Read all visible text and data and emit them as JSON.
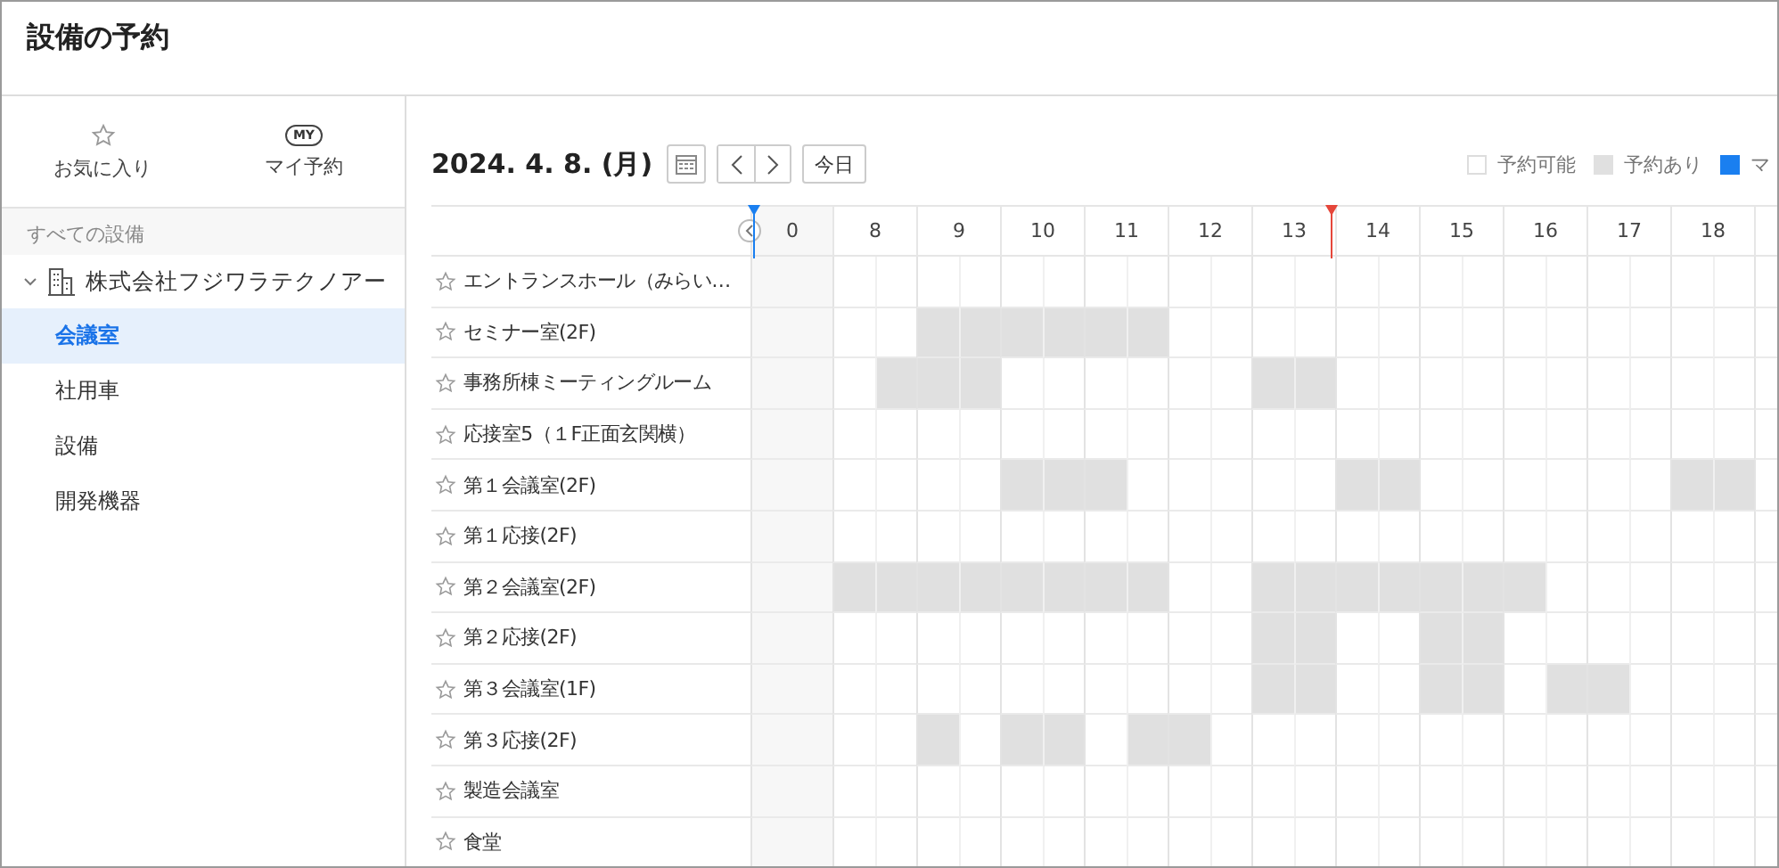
{
  "window": {
    "title": "設備の予約"
  },
  "sidebar": {
    "tabs": [
      {
        "kind": "favorites",
        "label": "お気に入り"
      },
      {
        "kind": "mine",
        "label": "マイ予約",
        "icon_text": "MY"
      }
    ],
    "section_title": "すべての設備",
    "tree": [
      {
        "label": "株式会社フジワラテクノアー",
        "expanded": true,
        "children": [
          {
            "label": "会議室",
            "selected": true
          },
          {
            "label": "社用車",
            "selected": false
          },
          {
            "label": "設備",
            "selected": false
          },
          {
            "label": "開発機器",
            "selected": false
          }
        ]
      }
    ]
  },
  "toolbar": {
    "date": "2024. 4. 8. (月)",
    "today_button": "今日"
  },
  "legend": [
    {
      "kind": "available",
      "label": "予約可能"
    },
    {
      "kind": "booked",
      "label": "予約あり"
    },
    {
      "kind": "mine",
      "label": "マ"
    }
  ],
  "hours": [
    {
      "label": "0",
      "collapsed": true
    },
    {
      "label": "8",
      "collapsed": false
    },
    {
      "label": "9",
      "collapsed": false
    },
    {
      "label": "10",
      "collapsed": false
    },
    {
      "label": "11",
      "collapsed": false
    },
    {
      "label": "12",
      "collapsed": false
    },
    {
      "label": "13",
      "collapsed": false
    },
    {
      "label": "14",
      "collapsed": false
    },
    {
      "label": "15",
      "collapsed": false
    },
    {
      "label": "16",
      "collapsed": false
    },
    {
      "label": "17",
      "collapsed": false
    },
    {
      "label": "18",
      "collapsed": false
    }
  ],
  "rows": [
    {
      "name": "エントランスホール（みらい…",
      "favorite": false,
      "slots": [
        false,
        false,
        false,
        false,
        false,
        false,
        false,
        false,
        false,
        false,
        false,
        false,
        false,
        false,
        false,
        false,
        false,
        false,
        false,
        false,
        false,
        false
      ]
    },
    {
      "name": "セミナー室(2F)",
      "favorite": false,
      "slots": [
        false,
        false,
        true,
        true,
        true,
        true,
        true,
        true,
        false,
        false,
        false,
        false,
        false,
        false,
        false,
        false,
        false,
        false,
        false,
        false,
        false,
        false
      ]
    },
    {
      "name": "事務所棟ミーティングルーム",
      "favorite": false,
      "slots": [
        false,
        true,
        true,
        true,
        false,
        false,
        false,
        false,
        false,
        false,
        true,
        true,
        false,
        false,
        false,
        false,
        false,
        false,
        false,
        false,
        false,
        false
      ]
    },
    {
      "name": "応接室5（１F正面玄関横）",
      "favorite": false,
      "slots": [
        false,
        false,
        false,
        false,
        false,
        false,
        false,
        false,
        false,
        false,
        false,
        false,
        false,
        false,
        false,
        false,
        false,
        false,
        false,
        false,
        false,
        false
      ]
    },
    {
      "name": "第１会議室(2F)",
      "favorite": false,
      "slots": [
        false,
        false,
        false,
        false,
        true,
        true,
        true,
        false,
        false,
        false,
        false,
        false,
        true,
        true,
        false,
        false,
        false,
        false,
        false,
        false,
        true,
        true
      ]
    },
    {
      "name": "第１応接(2F)",
      "favorite": false,
      "slots": [
        false,
        false,
        false,
        false,
        false,
        false,
        false,
        false,
        false,
        false,
        false,
        false,
        false,
        false,
        false,
        false,
        false,
        false,
        false,
        false,
        false,
        false
      ]
    },
    {
      "name": "第２会議室(2F)",
      "favorite": false,
      "slots": [
        true,
        true,
        true,
        true,
        true,
        true,
        true,
        true,
        false,
        false,
        true,
        true,
        true,
        true,
        true,
        true,
        true,
        false,
        false,
        false,
        false,
        false
      ]
    },
    {
      "name": "第２応接(2F)",
      "favorite": false,
      "slots": [
        false,
        false,
        false,
        false,
        false,
        false,
        false,
        false,
        false,
        false,
        true,
        true,
        false,
        false,
        true,
        true,
        false,
        false,
        false,
        false,
        false,
        false
      ]
    },
    {
      "name": "第３会議室(1F)",
      "favorite": false,
      "slots": [
        false,
        false,
        false,
        false,
        false,
        false,
        false,
        false,
        false,
        false,
        true,
        true,
        false,
        false,
        true,
        true,
        false,
        true,
        true,
        false,
        false,
        false
      ]
    },
    {
      "name": "第３応接(2F)",
      "favorite": false,
      "slots": [
        false,
        false,
        true,
        false,
        true,
        true,
        false,
        true,
        true,
        false,
        false,
        false,
        false,
        false,
        false,
        false,
        false,
        false,
        false,
        false,
        false,
        false
      ]
    },
    {
      "name": "製造会議室",
      "favorite": false,
      "slots": [
        false,
        false,
        false,
        false,
        false,
        false,
        false,
        false,
        false,
        false,
        false,
        false,
        false,
        false,
        false,
        false,
        false,
        false,
        false,
        false,
        false,
        false
      ]
    },
    {
      "name": "食堂",
      "favorite": false,
      "slots": [
        false,
        false,
        false,
        false,
        false,
        false,
        false,
        false,
        false,
        false,
        false,
        false,
        false,
        false,
        false,
        false,
        false,
        false,
        false,
        false,
        false,
        false
      ]
    }
  ]
}
